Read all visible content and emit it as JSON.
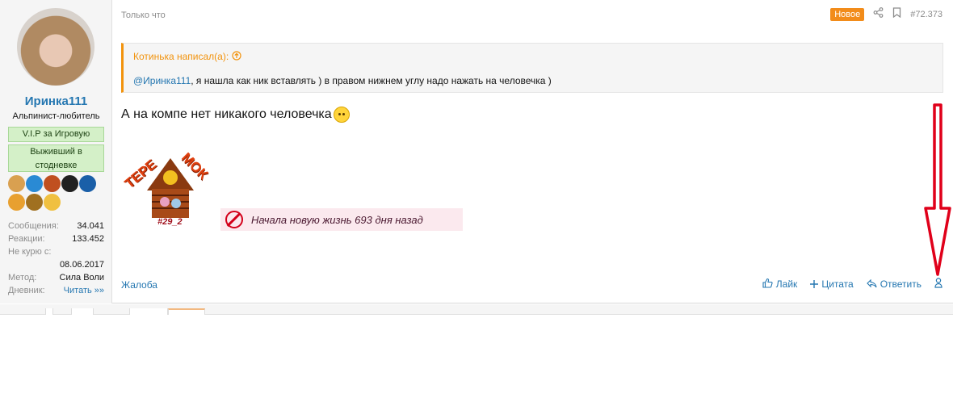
{
  "sidebar": {
    "username": "Иринка111",
    "user_title": "Альпинист-любитель",
    "banners": [
      "V.I.P за Игровую",
      "Выживший в стодневке"
    ],
    "awards": [
      {
        "icon": "cake-award-icon",
        "color": "#d9a050"
      },
      {
        "icon": "person-award-icon",
        "color": "#2a8ad4"
      },
      {
        "icon": "horse-award-icon",
        "color": "#c05020"
      },
      {
        "icon": "virus-award-icon",
        "color": "#202020"
      },
      {
        "icon": "people-award-icon",
        "color": "#1a5fa8"
      },
      {
        "icon": "emblem-award-icon",
        "color": "#e8a030"
      },
      {
        "icon": "gear-award-icon",
        "color": "#a07020"
      },
      {
        "icon": "medal-award-icon",
        "color": "#f0c040"
      }
    ],
    "stats": {
      "messages_label": "Сообщения:",
      "messages_value": "34.041",
      "reactions_label": "Реакции:",
      "reactions_value": "133.452",
      "no_smoke_label": "Не курю с:",
      "no_smoke_value": "08.06.2017",
      "method_label": "Метод:",
      "method_value": "Сила Воли",
      "diary_label": "Дневник:",
      "diary_value": "Читать »»"
    }
  },
  "post": {
    "time": "Только что",
    "new_badge": "Новое",
    "post_number": "#72.373",
    "quote": {
      "author": "Котинька написал(а):",
      "mention": "@Иринка111",
      "text": ", я нашла как ник вставлять ) в правом нижнем углу надо нажать на человечка )"
    },
    "message": "А на компе нет никакого человечка",
    "signature": {
      "teremok_left": "ТЕРЕ",
      "teremok_right": "МОК",
      "teremok_number": "#29_2",
      "banner_text": "Начала новую жизнь 693 дня назад"
    },
    "footer": {
      "report": "Жалоба",
      "like": "Лайк",
      "quote": "Цитата",
      "reply": "Ответить"
    }
  },
  "colors": {
    "link": "#2577b1",
    "accent": "#f2930d",
    "annotation_arrow": "#e0001a"
  }
}
